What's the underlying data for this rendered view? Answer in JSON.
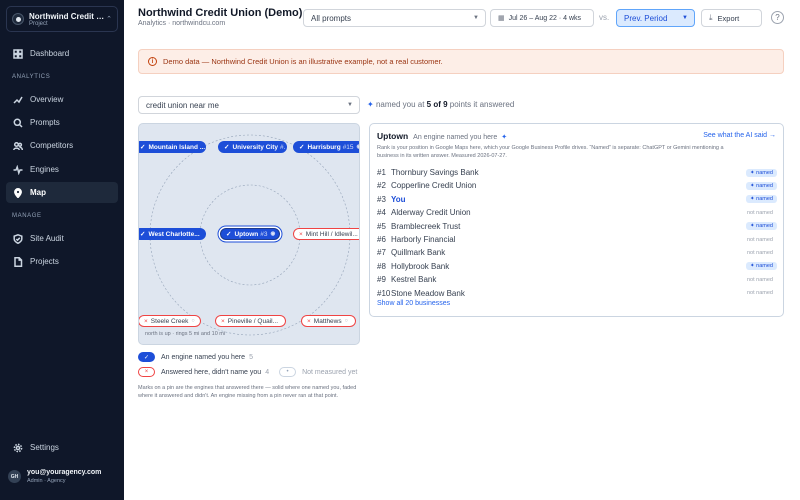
{
  "workspace": {
    "name": "Northwind Credit Union",
    "sub": "Project"
  },
  "sidebar": {
    "dashboard": "Dashboard",
    "analytics_heading": "ANALYTICS",
    "analytics": [
      "Overview",
      "Prompts",
      "Competitors",
      "Engines",
      "Map"
    ],
    "manage_heading": "MANAGE",
    "manage": [
      "Site Audit",
      "Projects"
    ],
    "settings": "Settings",
    "active": "Map"
  },
  "user": {
    "initials": "GH",
    "email": "you@youragency.com",
    "role": "Admin · Agency"
  },
  "header": {
    "title": "Northwind Credit Union (Demo)",
    "subtitle": "Analytics · northwindcu.com",
    "prompts_select": "All prompts",
    "date_range": "Jul 26 – Aug 22 · 4 wks",
    "vs": "vs.",
    "compare": "Prev. Period",
    "export": "Export",
    "help": "?"
  },
  "banner": "Demo data — Northwind Credit Union is an illustrative example, not a real customer.",
  "query": {
    "value": "credit union near me",
    "named_prefix": "named you at",
    "named_count": "5 of 9",
    "named_suffix": "points it answered"
  },
  "map": {
    "note": "north is up · rings 5 mi and 10 mi",
    "pins": [
      {
        "label": "Mountain Island ...",
        "status": "named"
      },
      {
        "label": "University City",
        "rank": "#...",
        "status": "named"
      },
      {
        "label": "Harrisburg",
        "rank": "#15",
        "status": "named"
      },
      {
        "label": "West Charlotte...",
        "status": "named"
      },
      {
        "label": "Uptown",
        "rank": "#3",
        "status": "you"
      },
      {
        "label": "Mint Hill / Idlewil...",
        "status": "not"
      },
      {
        "label": "Steele Creek",
        "status": "not"
      },
      {
        "label": "Pineville / Quail...",
        "status": "not"
      },
      {
        "label": "Matthews",
        "status": "not"
      }
    ]
  },
  "legend": [
    {
      "marker": "✓",
      "label": "An engine named you here",
      "count": "5",
      "kind": "named"
    },
    {
      "marker": "×",
      "label": "Answered here, didn't name you",
      "count": "4",
      "kind": "not"
    },
    {
      "marker": "•",
      "label": "Not measured yet",
      "count": "",
      "kind": "miss"
    }
  ],
  "legend_note": "Marks on a pin are the engines that answered there — solid where one named you, faded where it answered and didn't. An engine missing from a pin never ran at that point.",
  "panel": {
    "title": "Uptown",
    "subtitle": "An engine named you here",
    "link": "See what the AI said →",
    "description": "Rank is your position in Google Maps here, which your Google Business Profile drives. “Named” is separate: ChatGPT or Gemini mentioning a business in its written answer. Measured 2026-07-27.",
    "ranks": [
      {
        "pos": "#1",
        "name": "Thornbury Savings Bank",
        "badge": "named"
      },
      {
        "pos": "#2",
        "name": "Copperline Credit Union",
        "badge": "named"
      },
      {
        "pos": "#3",
        "name": "You",
        "badge": "named",
        "you": true
      },
      {
        "pos": "#4",
        "name": "Alderway Credit Union",
        "badge": "not named"
      },
      {
        "pos": "#5",
        "name": "Bramblecreek Trust",
        "badge": "named"
      },
      {
        "pos": "#6",
        "name": "Harborly Financial",
        "badge": "not named"
      },
      {
        "pos": "#7",
        "name": "Quillmark Bank",
        "badge": "not named"
      },
      {
        "pos": "#8",
        "name": "Hollybrook Bank",
        "badge": "named"
      },
      {
        "pos": "#9",
        "name": "Kestrel Bank",
        "badge": "not named"
      },
      {
        "pos": "#10",
        "name": "Stone Meadow Bank",
        "badge": "not named"
      }
    ],
    "show_all": "Show all 20 businesses"
  },
  "colors": {
    "accent": "#1d4ed8",
    "sidebar_bg": "#0f1729",
    "not_named": "#ef4444",
    "banner_bg": "#fdeee7"
  }
}
